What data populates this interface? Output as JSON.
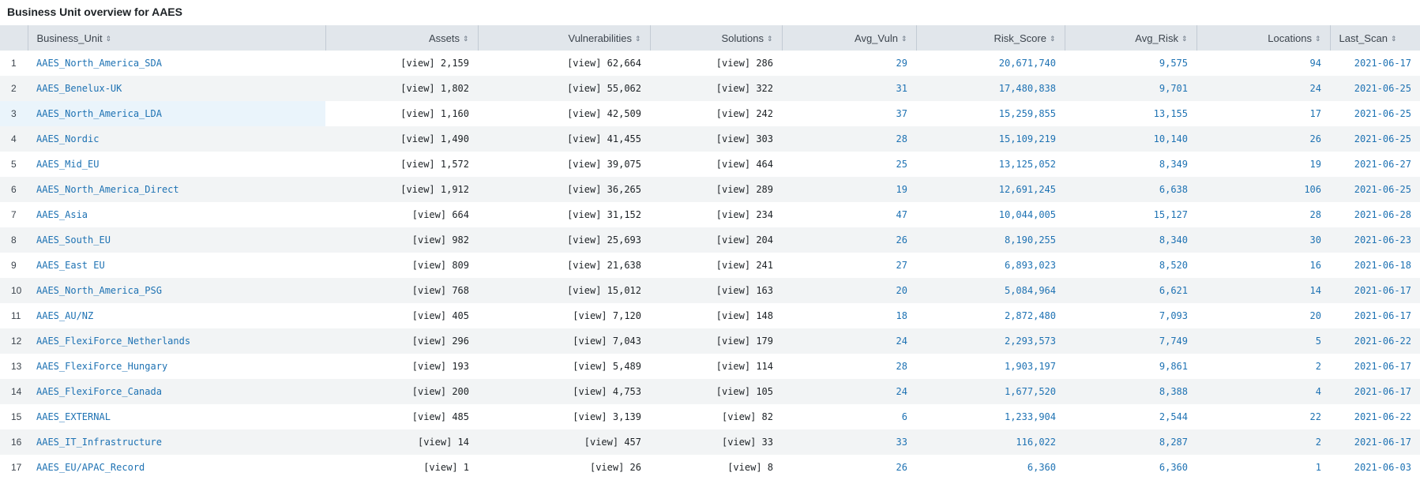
{
  "panel": {
    "title": "Business Unit overview for AAES"
  },
  "table": {
    "columns": [
      "Business_Unit",
      "Assets",
      "Vulnerabilities",
      "Solutions",
      "Avg_Vuln",
      "Risk_Score",
      "Avg_Risk",
      "Locations",
      "Last_Scan"
    ],
    "rows": [
      {
        "n": "1",
        "bu": "AAES_North_America_SDA",
        "assets": "[view] 2,159",
        "vulns": "[view] 62,664",
        "solutions": "[view] 286",
        "avg_vuln": "29",
        "risk_score": "20,671,740",
        "avg_risk": "9,575",
        "locations": "94",
        "last_scan": "2021-06-17"
      },
      {
        "n": "2",
        "bu": "AAES_Benelux-UK",
        "assets": "[view] 1,802",
        "vulns": "[view] 55,062",
        "solutions": "[view] 322",
        "avg_vuln": "31",
        "risk_score": "17,480,838",
        "avg_risk": "9,701",
        "locations": "24",
        "last_scan": "2021-06-25"
      },
      {
        "n": "3",
        "bu": "AAES_North_America_LDA",
        "assets": "[view] 1,160",
        "vulns": "[view] 42,509",
        "solutions": "[view] 242",
        "avg_vuln": "37",
        "risk_score": "15,259,855",
        "avg_risk": "13,155",
        "locations": "17",
        "last_scan": "2021-06-25"
      },
      {
        "n": "4",
        "bu": "AAES_Nordic",
        "assets": "[view] 1,490",
        "vulns": "[view] 41,455",
        "solutions": "[view] 303",
        "avg_vuln": "28",
        "risk_score": "15,109,219",
        "avg_risk": "10,140",
        "locations": "26",
        "last_scan": "2021-06-25"
      },
      {
        "n": "5",
        "bu": "AAES_Mid_EU",
        "assets": "[view] 1,572",
        "vulns": "[view] 39,075",
        "solutions": "[view] 464",
        "avg_vuln": "25",
        "risk_score": "13,125,052",
        "avg_risk": "8,349",
        "locations": "19",
        "last_scan": "2021-06-27"
      },
      {
        "n": "6",
        "bu": "AAES_North_America_Direct",
        "assets": "[view] 1,912",
        "vulns": "[view] 36,265",
        "solutions": "[view] 289",
        "avg_vuln": "19",
        "risk_score": "12,691,245",
        "avg_risk": "6,638",
        "locations": "106",
        "last_scan": "2021-06-25"
      },
      {
        "n": "7",
        "bu": "AAES_Asia",
        "assets": "[view] 664",
        "vulns": "[view] 31,152",
        "solutions": "[view] 234",
        "avg_vuln": "47",
        "risk_score": "10,044,005",
        "avg_risk": "15,127",
        "locations": "28",
        "last_scan": "2021-06-28"
      },
      {
        "n": "8",
        "bu": "AAES_South_EU",
        "assets": "[view] 982",
        "vulns": "[view] 25,693",
        "solutions": "[view] 204",
        "avg_vuln": "26",
        "risk_score": "8,190,255",
        "avg_risk": "8,340",
        "locations": "30",
        "last_scan": "2021-06-23"
      },
      {
        "n": "9",
        "bu": "AAES_East EU",
        "assets": "[view] 809",
        "vulns": "[view] 21,638",
        "solutions": "[view] 241",
        "avg_vuln": "27",
        "risk_score": "6,893,023",
        "avg_risk": "8,520",
        "locations": "16",
        "last_scan": "2021-06-18"
      },
      {
        "n": "10",
        "bu": "AAES_North_America_PSG",
        "assets": "[view] 768",
        "vulns": "[view] 15,012",
        "solutions": "[view] 163",
        "avg_vuln": "20",
        "risk_score": "5,084,964",
        "avg_risk": "6,621",
        "locations": "14",
        "last_scan": "2021-06-17"
      },
      {
        "n": "11",
        "bu": "AAES_AU/NZ",
        "assets": "[view] 405",
        "vulns": "[view] 7,120",
        "solutions": "[view] 148",
        "avg_vuln": "18",
        "risk_score": "2,872,480",
        "avg_risk": "7,093",
        "locations": "20",
        "last_scan": "2021-06-17"
      },
      {
        "n": "12",
        "bu": "AAES_FlexiForce_Netherlands",
        "assets": "[view] 296",
        "vulns": "[view] 7,043",
        "solutions": "[view] 179",
        "avg_vuln": "24",
        "risk_score": "2,293,573",
        "avg_risk": "7,749",
        "locations": "5",
        "last_scan": "2021-06-22"
      },
      {
        "n": "13",
        "bu": "AAES_FlexiForce_Hungary",
        "assets": "[view] 193",
        "vulns": "[view] 5,489",
        "solutions": "[view] 114",
        "avg_vuln": "28",
        "risk_score": "1,903,197",
        "avg_risk": "9,861",
        "locations": "2",
        "last_scan": "2021-06-17"
      },
      {
        "n": "14",
        "bu": "AAES_FlexiForce_Canada",
        "assets": "[view] 200",
        "vulns": "[view] 4,753",
        "solutions": "[view] 105",
        "avg_vuln": "24",
        "risk_score": "1,677,520",
        "avg_risk": "8,388",
        "locations": "4",
        "last_scan": "2021-06-17"
      },
      {
        "n": "15",
        "bu": "AAES_EXTERNAL",
        "assets": "[view] 485",
        "vulns": "[view] 3,139",
        "solutions": "[view] 82",
        "avg_vuln": "6",
        "risk_score": "1,233,904",
        "avg_risk": "2,544",
        "locations": "22",
        "last_scan": "2021-06-22"
      },
      {
        "n": "16",
        "bu": "AAES_IT_Infrastructure",
        "assets": "[view] 14",
        "vulns": "[view] 457",
        "solutions": "[view] 33",
        "avg_vuln": "33",
        "risk_score": "116,022",
        "avg_risk": "8,287",
        "locations": "2",
        "last_scan": "2021-06-17"
      },
      {
        "n": "17",
        "bu": "AAES_EU/APAC_Record",
        "assets": "[view] 1",
        "vulns": "[view] 26",
        "solutions": "[view] 8",
        "avg_vuln": "26",
        "risk_score": "6,360",
        "avg_risk": "6,360",
        "locations": "1",
        "last_scan": "2021-06-03"
      }
    ]
  },
  "icons": {
    "sort": "sort-icon"
  },
  "colors": {
    "link": "#1e72b3",
    "header_bg": "#e1e6eb",
    "stripe": "#f2f4f5",
    "highlight": "#eaf4fb"
  }
}
